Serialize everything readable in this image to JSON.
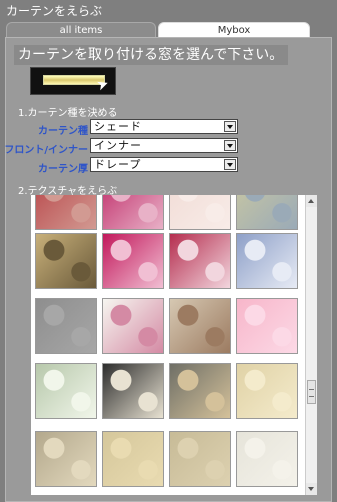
{
  "app": {
    "title": "カーテンをえらぶ"
  },
  "tabs": [
    {
      "label": "all items"
    },
    {
      "label": "Mybox"
    }
  ],
  "headline": "カーテンを取り付ける窓を選んで下さい。",
  "section1": {
    "title": "1.カーテン種を決める"
  },
  "fields": [
    {
      "label": "カーテン種",
      "value": "シェード"
    },
    {
      "label": "フロント/インナー",
      "value": "インナー"
    },
    {
      "label": "カーテン厚",
      "value": "ドレープ"
    }
  ],
  "section2": {
    "title": "2.テクスチャをえらぶ"
  },
  "textures": [
    {
      "colors": [
        "#b9484b",
        "#d29a92"
      ]
    },
    {
      "colors": [
        "#c02e6a",
        "#e8b1c7"
      ]
    },
    {
      "colors": [
        "#f1dcd6",
        "#f8ece8"
      ]
    },
    {
      "colors": [
        "#c9c7a2",
        "#9aaab7"
      ]
    },
    {
      "colors": [
        "#c8b07a",
        "#6a5a3a"
      ]
    },
    {
      "colors": [
        "#c2185b",
        "#f1bfd3"
      ]
    },
    {
      "colors": [
        "#b52e4f",
        "#f2d6de"
      ]
    },
    {
      "colors": [
        "#8ea0c8",
        "#e7ebf5"
      ]
    },
    {
      "colors": [
        "#8e8e8e",
        "#a7a7a7"
      ]
    },
    {
      "colors": [
        "#f6f6f0",
        "#d48aa4"
      ]
    },
    {
      "colors": [
        "#d6c8b2",
        "#9c7b61"
      ]
    },
    {
      "colors": [
        "#f7b6ca",
        "#fcd9e6"
      ]
    },
    {
      "colors": [
        "#b7c8ab",
        "#f1f6ea"
      ]
    },
    {
      "colors": [
        "#2d2d2d",
        "#e8e2d2"
      ]
    },
    {
      "colors": [
        "#6f6f66",
        "#d4c19a"
      ]
    },
    {
      "colors": [
        "#e0d2a6",
        "#f4ebcc"
      ]
    },
    {
      "colors": [
        "#b3a88c",
        "#e3d9be"
      ]
    },
    {
      "colors": [
        "#d5c79b",
        "#e9dbb1"
      ]
    },
    {
      "colors": [
        "#c7bb97",
        "#ddd1b0"
      ]
    },
    {
      "colors": [
        "#e6e4da",
        "#f4f2ea"
      ]
    }
  ]
}
